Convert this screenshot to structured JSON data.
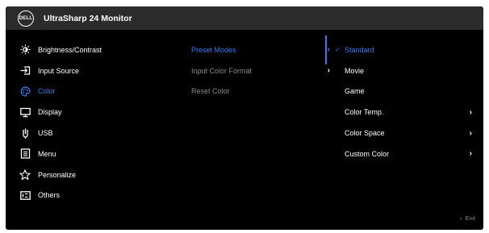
{
  "header": {
    "logo_text": "DELL",
    "title": "UltraSharp 24 Monitor"
  },
  "menu": [
    {
      "label": "Brightness/Contrast",
      "icon": "brightness-icon"
    },
    {
      "label": "Input Source",
      "icon": "input-source-icon"
    },
    {
      "label": "Color",
      "icon": "color-palette-icon",
      "selected": true
    },
    {
      "label": "Display",
      "icon": "display-icon"
    },
    {
      "label": "USB",
      "icon": "usb-icon"
    },
    {
      "label": "Menu",
      "icon": "menu-icon"
    },
    {
      "label": "Personalize",
      "icon": "star-icon"
    },
    {
      "label": "Others",
      "icon": "others-icon"
    }
  ],
  "submenu": [
    {
      "label": "Preset Modes",
      "arrow": "›",
      "active": true
    },
    {
      "label": "Input Color Format",
      "arrow": "›",
      "disabled": true
    },
    {
      "label": "Reset Color",
      "disabled": true
    }
  ],
  "options": [
    {
      "label": "Standard",
      "checked": true,
      "check": "✓"
    },
    {
      "label": "Movie"
    },
    {
      "label": "Game"
    },
    {
      "label": "Color Temp.",
      "arrow": "›"
    },
    {
      "label": "Color Space",
      "arrow": "›"
    },
    {
      "label": "Custom Color",
      "arrow": "›"
    }
  ],
  "footer": {
    "back_glyph": "‹",
    "exit_label": "Exit"
  },
  "colors": {
    "accent": "#2f7cf0",
    "disabled": "#8a8a8a",
    "background": "#000000",
    "header": "#2b2b2b"
  }
}
